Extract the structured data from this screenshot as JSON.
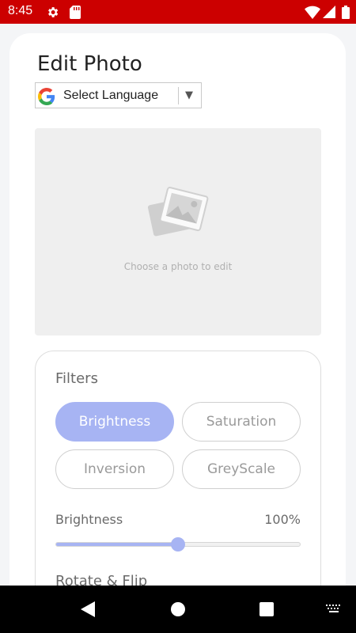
{
  "status_bar": {
    "time": "8:45",
    "icons": [
      "settings-gear-icon",
      "sd-card-icon",
      "wifi-icon",
      "cell-signal-icon",
      "battery-icon"
    ],
    "color": "#cc0000"
  },
  "page": {
    "title": "Edit Photo"
  },
  "language": {
    "icon": "google-g-icon",
    "label": "Select Language",
    "arrow": "▼"
  },
  "photo": {
    "icon": "image-placeholder-icon",
    "hint": "Choose a photo to edit"
  },
  "filters": {
    "title": "Filters",
    "options": [
      {
        "label": "Brightness",
        "active": true
      },
      {
        "label": "Saturation",
        "active": false
      },
      {
        "label": "Inversion",
        "active": false
      },
      {
        "label": "GreyScale",
        "active": false
      }
    ],
    "accent": "#a7b4f3"
  },
  "slider": {
    "label": "Brightness",
    "value_text": "100%",
    "fraction": 0.5
  },
  "rotate": {
    "title": "Rotate & Flip"
  },
  "nav_bar": {
    "icons": [
      "back-icon",
      "home-icon",
      "recents-icon",
      "keyboard-icon"
    ]
  }
}
